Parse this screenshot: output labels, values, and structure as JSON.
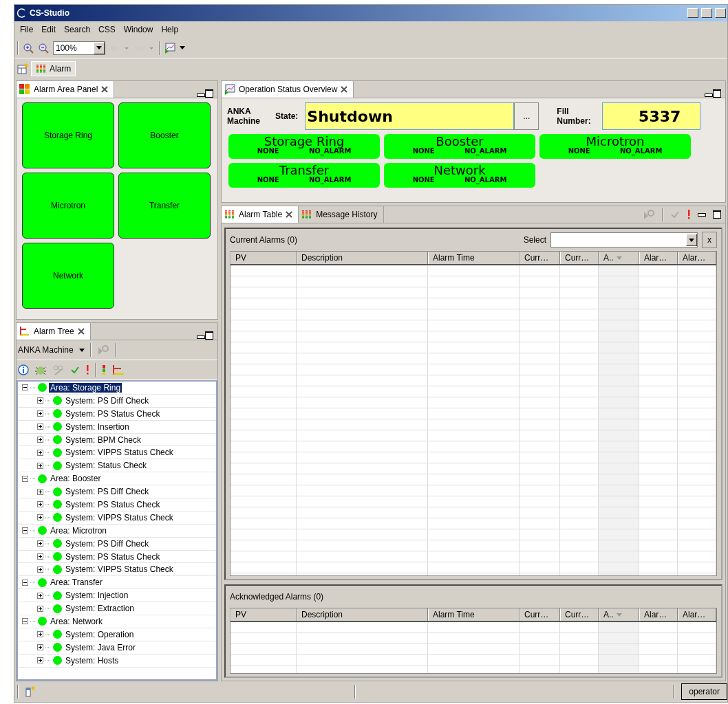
{
  "window": {
    "title": "CS-Studio"
  },
  "menu": [
    "File",
    "Edit",
    "Search",
    "CSS",
    "Window",
    "Help"
  ],
  "toolbar": {
    "zoom": "100%"
  },
  "perspective": {
    "label": "Alarm"
  },
  "area_panel": {
    "title": "Alarm Area Panel",
    "tiles": [
      "Storage Ring",
      "Booster",
      "Microtron",
      "Transfer",
      "Network"
    ]
  },
  "alarm_tree": {
    "title": "Alarm Tree",
    "config": "ANKA Machine",
    "items": [
      {
        "label": "Area: Storage Ring",
        "selected": true,
        "expanded": true,
        "children": [
          {
            "label": "System: PS Diff Check",
            "selected": false,
            "expanded": false
          },
          {
            "label": "System: PS Status Check",
            "selected": false,
            "expanded": false
          },
          {
            "label": "System: Insertion",
            "selected": false,
            "expanded": false
          },
          {
            "label": "System: BPM Check",
            "selected": false,
            "expanded": false
          },
          {
            "label": "System: VIPPS Status Check",
            "selected": false,
            "expanded": false
          },
          {
            "label": "System: Status Check",
            "selected": false,
            "expanded": false
          }
        ]
      },
      {
        "label": "Area: Booster",
        "selected": false,
        "expanded": true,
        "children": [
          {
            "label": "System: PS Diff Check",
            "selected": false,
            "expanded": false
          },
          {
            "label": "System: PS Status Check",
            "selected": false,
            "expanded": false
          },
          {
            "label": "System: VIPPS Status Check",
            "selected": false,
            "expanded": false
          }
        ]
      },
      {
        "label": "Area: Microtron",
        "selected": false,
        "expanded": true,
        "children": [
          {
            "label": "System: PS Diff Check",
            "selected": false,
            "expanded": false
          },
          {
            "label": "System: PS Status Check",
            "selected": false,
            "expanded": false
          },
          {
            "label": "System: VIPPS Status Check",
            "selected": false,
            "expanded": false
          }
        ]
      },
      {
        "label": "Area: Transfer",
        "selected": false,
        "expanded": true,
        "children": [
          {
            "label": "System: Injection",
            "selected": false,
            "expanded": false
          },
          {
            "label": "System: Extraction",
            "selected": false,
            "expanded": false
          }
        ]
      },
      {
        "label": "Area: Network",
        "selected": false,
        "expanded": true,
        "children": [
          {
            "label": "System: Operation",
            "selected": false,
            "expanded": false
          },
          {
            "label": "System: Java Error",
            "selected": false,
            "expanded": false
          },
          {
            "label": "System: Hosts",
            "selected": false,
            "expanded": false
          }
        ]
      }
    ]
  },
  "overview": {
    "title": "Operation Status Overview",
    "machine_label": "ANKA Machine",
    "state_label": "State:",
    "state": "Shutdown",
    "state_button": "...",
    "fill_label": "Fill Number:",
    "fill_number": "5337",
    "areas": [
      {
        "name": "Storage Ring",
        "severity": "NONE",
        "status": "NO_ALARM"
      },
      {
        "name": "Booster",
        "severity": "NONE",
        "status": "NO_ALARM"
      },
      {
        "name": "Microtron",
        "severity": "NONE",
        "status": "NO_ALARM"
      },
      {
        "name": "Transfer",
        "severity": "NONE",
        "status": "NO_ALARM"
      },
      {
        "name": "Network",
        "severity": "NONE",
        "status": "NO_ALARM"
      }
    ]
  },
  "alarm_tabs": [
    {
      "label": "Alarm Table",
      "selected": true
    },
    {
      "label": "Message History",
      "selected": false
    }
  ],
  "current_alarms": {
    "title": "Current Alarms (0)",
    "select_label": "Select",
    "clear_button": "x",
    "columns": [
      {
        "label": "PV",
        "sorted": false
      },
      {
        "label": "Description",
        "sorted": false
      },
      {
        "label": "Alarm Time",
        "sorted": false
      },
      {
        "label": "Curr…",
        "sorted": false
      },
      {
        "label": "Curr…",
        "sorted": false
      },
      {
        "label": "A..",
        "sorted": true
      },
      {
        "label": "Alar…",
        "sorted": false
      },
      {
        "label": "Alar…",
        "sorted": false
      }
    ]
  },
  "acknowledged_alarms": {
    "title": "Acknowledged Alarms (0)",
    "columns": [
      {
        "label": "PV",
        "sorted": false
      },
      {
        "label": "Description",
        "sorted": false
      },
      {
        "label": "Alarm Time",
        "sorted": false
      },
      {
        "label": "Curr…",
        "sorted": false
      },
      {
        "label": "Curr…",
        "sorted": false
      },
      {
        "label": "A..",
        "sorted": true
      },
      {
        "label": "Alar…",
        "sorted": false
      },
      {
        "label": "Alar…",
        "sorted": false
      }
    ]
  },
  "status_bar": {
    "user": "operator"
  }
}
